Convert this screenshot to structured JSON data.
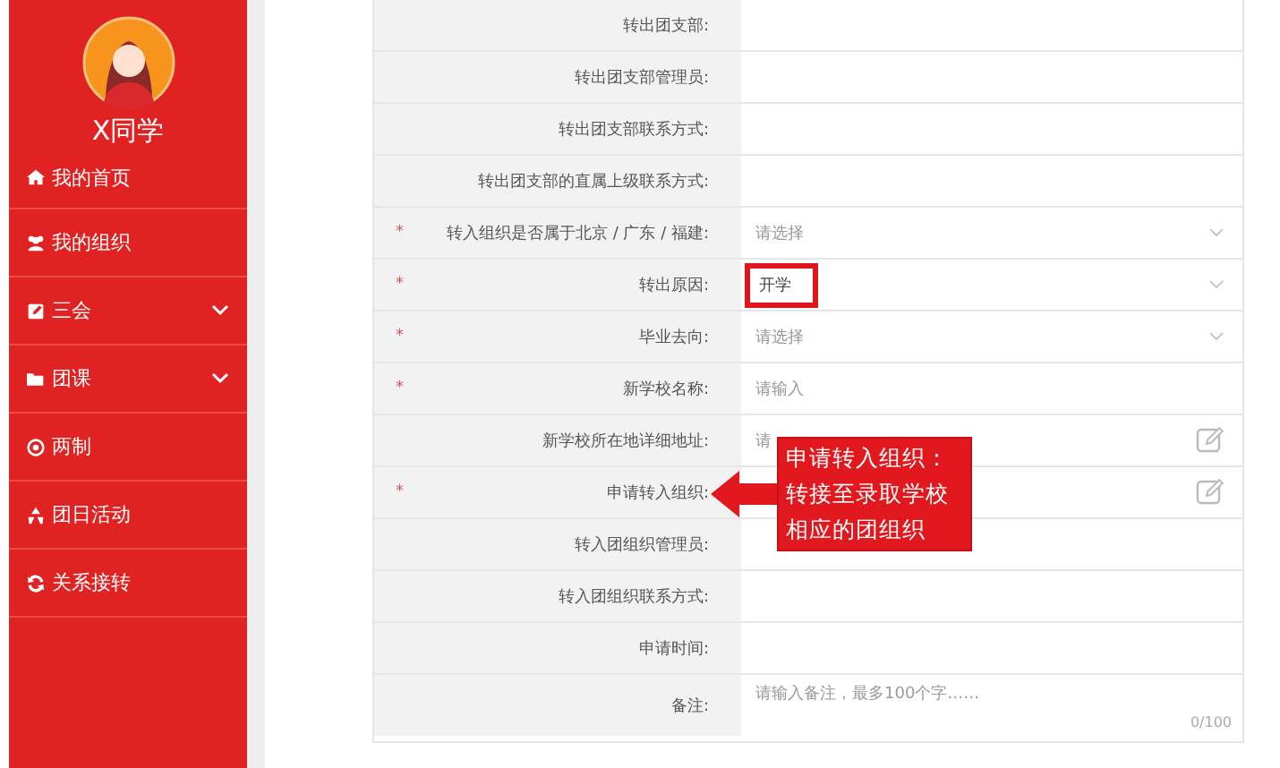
{
  "sidebar": {
    "user_name": "X同学",
    "items": [
      {
        "label": "我的首页",
        "expandable": false
      },
      {
        "label": "我的组织",
        "expandable": false
      },
      {
        "label": "三会",
        "expandable": true
      },
      {
        "label": "团课",
        "expandable": true
      },
      {
        "label": "两制",
        "expandable": false
      },
      {
        "label": "团日活动",
        "expandable": false
      },
      {
        "label": "关系接转",
        "expandable": false
      }
    ]
  },
  "form": {
    "rows": [
      {
        "label": "转出团支部:",
        "kind": "text"
      },
      {
        "label": "转出团支部管理员:",
        "kind": "text"
      },
      {
        "label": "转出团支部联系方式:",
        "kind": "text"
      },
      {
        "label": "转出团支部的直属上级联系方式:",
        "kind": "text"
      },
      {
        "label": "转入组织是否属于北京 / 广东 / 福建:",
        "required_mark": "*",
        "kind": "select",
        "placeholder": "请选择"
      },
      {
        "label": "转出原因:",
        "required_mark": "*",
        "kind": "select",
        "value": "开学",
        "highlighted": true
      },
      {
        "label": "毕业去向:",
        "required_mark": "*",
        "kind": "select",
        "placeholder": "请选择"
      },
      {
        "label": "新学校名称:",
        "required_mark": "*",
        "kind": "input",
        "placeholder": "请输入"
      },
      {
        "label": "新学校所在地详细地址:",
        "kind": "picker",
        "placeholder": "请"
      },
      {
        "label": "申请转入组织:",
        "required_mark": "*",
        "kind": "picker"
      },
      {
        "label": "转入团组织管理员:",
        "kind": "text"
      },
      {
        "label": "转入团组织联系方式:",
        "kind": "text"
      },
      {
        "label": "申请时间:",
        "kind": "text"
      },
      {
        "label": "备注:",
        "kind": "textarea",
        "placeholder": "请输入备注，最多100个字……",
        "counter": "0/100"
      }
    ]
  },
  "callout": {
    "text": "申请转入组织：转接至录取学校相应的团组织"
  }
}
